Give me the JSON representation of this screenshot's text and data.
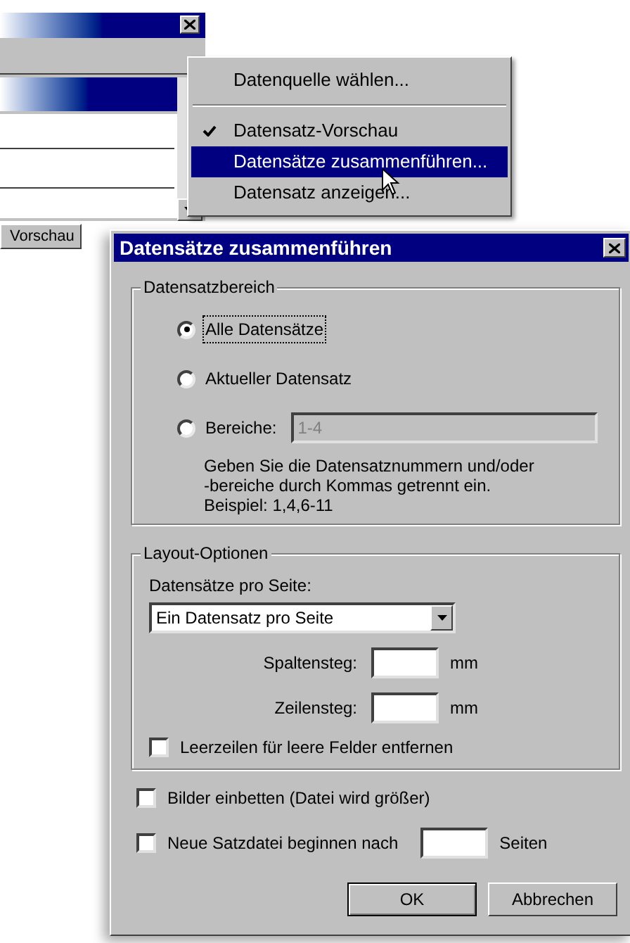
{
  "palette": {
    "tab_label": "Vorschau"
  },
  "menu": {
    "items": [
      {
        "kind": "item",
        "label": "Datenquelle wählen...",
        "checked": false,
        "selected": false
      },
      {
        "kind": "separator"
      },
      {
        "kind": "item",
        "label": "Datensatz-Vorschau",
        "checked": true,
        "selected": false
      },
      {
        "kind": "item",
        "label": "Datensätze zusammenführen...",
        "checked": false,
        "selected": true
      },
      {
        "kind": "item",
        "label": "Datensatz anzeigen...",
        "checked": false,
        "selected": false
      }
    ]
  },
  "dialog": {
    "title": "Datensätze zusammenführen",
    "record_range": {
      "title": "Datensatzbereich",
      "options": [
        {
          "label": "Alle Datensätze",
          "selected": true,
          "focused": true
        },
        {
          "label": "Aktueller Datensatz",
          "selected": false,
          "focused": false
        },
        {
          "label": "Bereiche:",
          "selected": false,
          "focused": false
        }
      ],
      "range_field": {
        "value": "1-4",
        "disabled": true
      },
      "hint": "Geben Sie die Datensatznummern und/oder\n-bereiche durch Kommas getrennt ein.\nBeispiel: 1,4,6-11"
    },
    "layout": {
      "title": "Layout-Optionen",
      "per_page_label": "Datensätze pro Seite:",
      "per_page_value": "Ein Datensatz pro Seite",
      "spacing_fields": [
        {
          "label": "Spaltensteg:",
          "unit": "mm"
        },
        {
          "label": "Zeilensteg:",
          "unit": "mm"
        }
      ],
      "remove_blank": {
        "label": "Leerzeilen für leere Felder entfernen",
        "checked": false
      }
    },
    "options": [
      {
        "label": "Bilder einbetten (Datei wird größer)",
        "checked": false
      },
      {
        "label": "Neue Satzdatei beginnen nach",
        "checked": false,
        "suffix": "Seiten"
      }
    ],
    "buttons": [
      {
        "label": "OK",
        "default": true
      },
      {
        "label": "Abbrechen",
        "default": false
      }
    ]
  }
}
